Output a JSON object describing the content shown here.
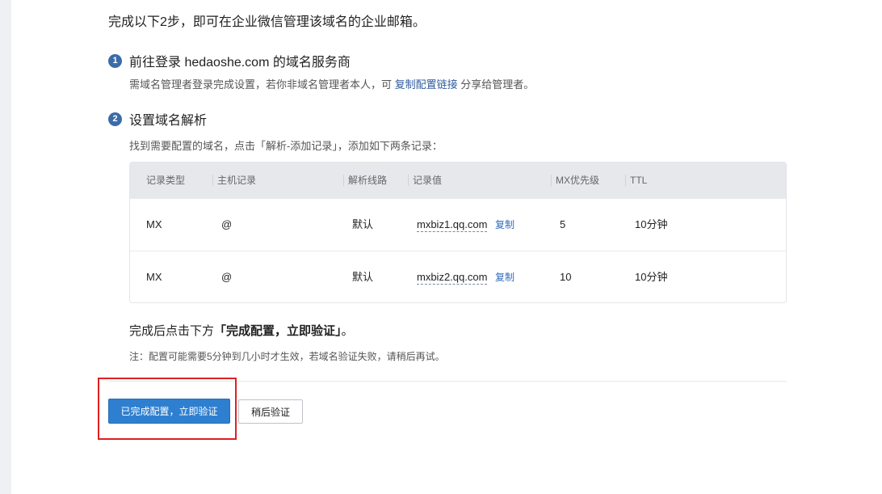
{
  "intro": "完成以下2步，即可在企业微信管理该域名的企业邮箱。",
  "step1": {
    "num": "1",
    "title": "前往登录 hedaoshe.com 的域名服务商",
    "desc_before": "需域名管理者登录完成设置，若你非域名管理者本人，可",
    "desc_link": "复制配置链接",
    "desc_after": "分享给管理者。"
  },
  "step2": {
    "num": "2",
    "title": "设置域名解析",
    "desc": "找到需要配置的域名，点击「解析-添加记录」，添加如下两条记录："
  },
  "table": {
    "headers": [
      "记录类型",
      "主机记录",
      "解析线路",
      "记录值",
      "MX优先级",
      "TTL"
    ],
    "copy_label": "复制",
    "rows": [
      {
        "type": "MX",
        "host": "@",
        "line": "默认",
        "value": "mxbiz1.qq.com",
        "priority": "5",
        "ttl": "10分钟"
      },
      {
        "type": "MX",
        "host": "@",
        "line": "默认",
        "value": "mxbiz2.qq.com",
        "priority": "10",
        "ttl": "10分钟"
      }
    ]
  },
  "done_tip": {
    "before": "完成后点击下方",
    "bold": "「完成配置，立即验证」",
    "after": "。"
  },
  "note": "注：配置可能需要5分钟到几小时才生效，若域名验证失败，请稍后再试。",
  "buttons": {
    "primary": "已完成配置，立即验证",
    "secondary": "稍后验证"
  },
  "colors": {
    "primary": "#2f7fd0",
    "link": "#2f5d9e",
    "highlight_box": "#e02020"
  }
}
